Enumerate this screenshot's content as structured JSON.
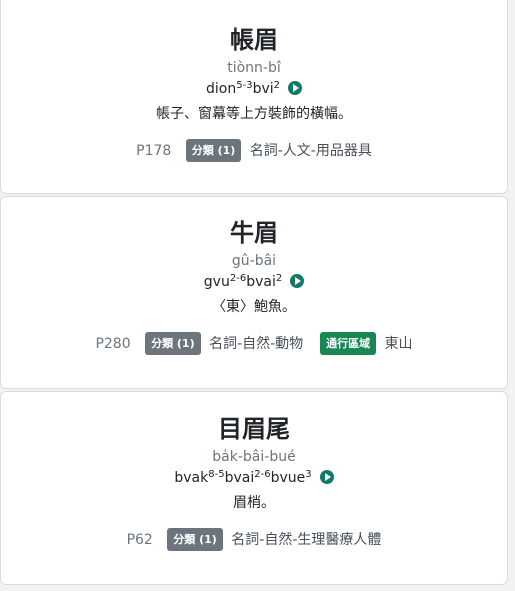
{
  "entries": [
    {
      "headword": "帳眉",
      "romanization": "tiònn-bî",
      "pron": [
        {
          "base": "dion",
          "tone": "5-3"
        },
        {
          "base": "bvi",
          "tone": "2"
        }
      ],
      "definition": "帳子、窗幕等上方裝飾的橫幅。",
      "page": "P178",
      "category_badge": "分類 (1)",
      "category": "名詞-人文-用品器具"
    },
    {
      "headword": "牛眉",
      "romanization": "gû-bâi",
      "pron": [
        {
          "base": "gvu",
          "tone": "2-6"
        },
        {
          "base": "bvai",
          "tone": "2"
        }
      ],
      "definition": "〈東〉鮑魚。",
      "page": "P280",
      "category_badge": "分類 (1)",
      "category": "名詞-自然-動物",
      "region_badge": "通行區域",
      "region": "東山"
    },
    {
      "headword": "目眉尾",
      "romanization": "ba̍k-bâi-bué",
      "pron": [
        {
          "base": "bvak",
          "tone": "8-5"
        },
        {
          "base": "bvai",
          "tone": "2-6"
        },
        {
          "base": "bvue",
          "tone": "3"
        }
      ],
      "definition": "眉梢。",
      "page": "P62",
      "category_badge": "分類 (1)",
      "category": "名詞-自然-生理醫療人體"
    }
  ],
  "colors": {
    "play_button": "#0f7a6a",
    "category_badge": "#6c757d",
    "region_badge": "#198754"
  },
  "icons": {
    "play": "play-circle-icon"
  }
}
